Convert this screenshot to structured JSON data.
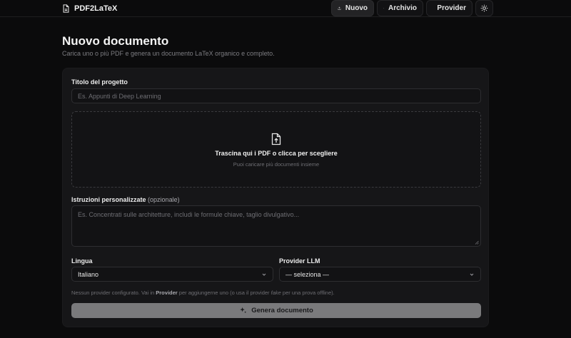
{
  "header": {
    "brand": "PDF2LaTeX",
    "nav": [
      {
        "label": "Nuovo",
        "icon": "upload-icon",
        "active": true
      },
      {
        "label": "Archivio",
        "icon": "history-icon",
        "active": false
      },
      {
        "label": "Provider",
        "icon": "gear-icon",
        "active": false
      },
      {
        "label": "",
        "icon": "sun-icon",
        "active": false
      }
    ]
  },
  "page": {
    "title": "Nuovo documento",
    "subtitle": "Carica uno o più PDF e genera un documento LaTeX organico e completo."
  },
  "form": {
    "title_label": "Titolo del progetto",
    "title_placeholder": "Es. Appunti di Deep Learning",
    "dropzone_title": "Trascina qui i PDF o clicca per scegliere",
    "dropzone_subtitle": "Puoi caricare più documenti insieme",
    "instructions_label": "Istruzioni personalizzate",
    "instructions_optional": "(opzionale)",
    "instructions_placeholder": "Es. Concentrati sulle architetture, includi le formule chiave, taglio divulgativo...",
    "language_label": "Lingua",
    "language_value": "Italiano",
    "provider_label": "Provider LLM",
    "provider_value": "— seleziona —",
    "hint_before": "Nessun provider configurato. Vai in ",
    "hint_link": "Provider",
    "hint_middle": " per aggiungerne uno (o usa il provider ",
    "hint_fake": "fake",
    "hint_after": " per una prova offline).",
    "submit_label": "Genera documento"
  },
  "colors": {
    "background": "#0b0b0c",
    "card": "#161618",
    "button_disabled": "#7a7a7c"
  }
}
